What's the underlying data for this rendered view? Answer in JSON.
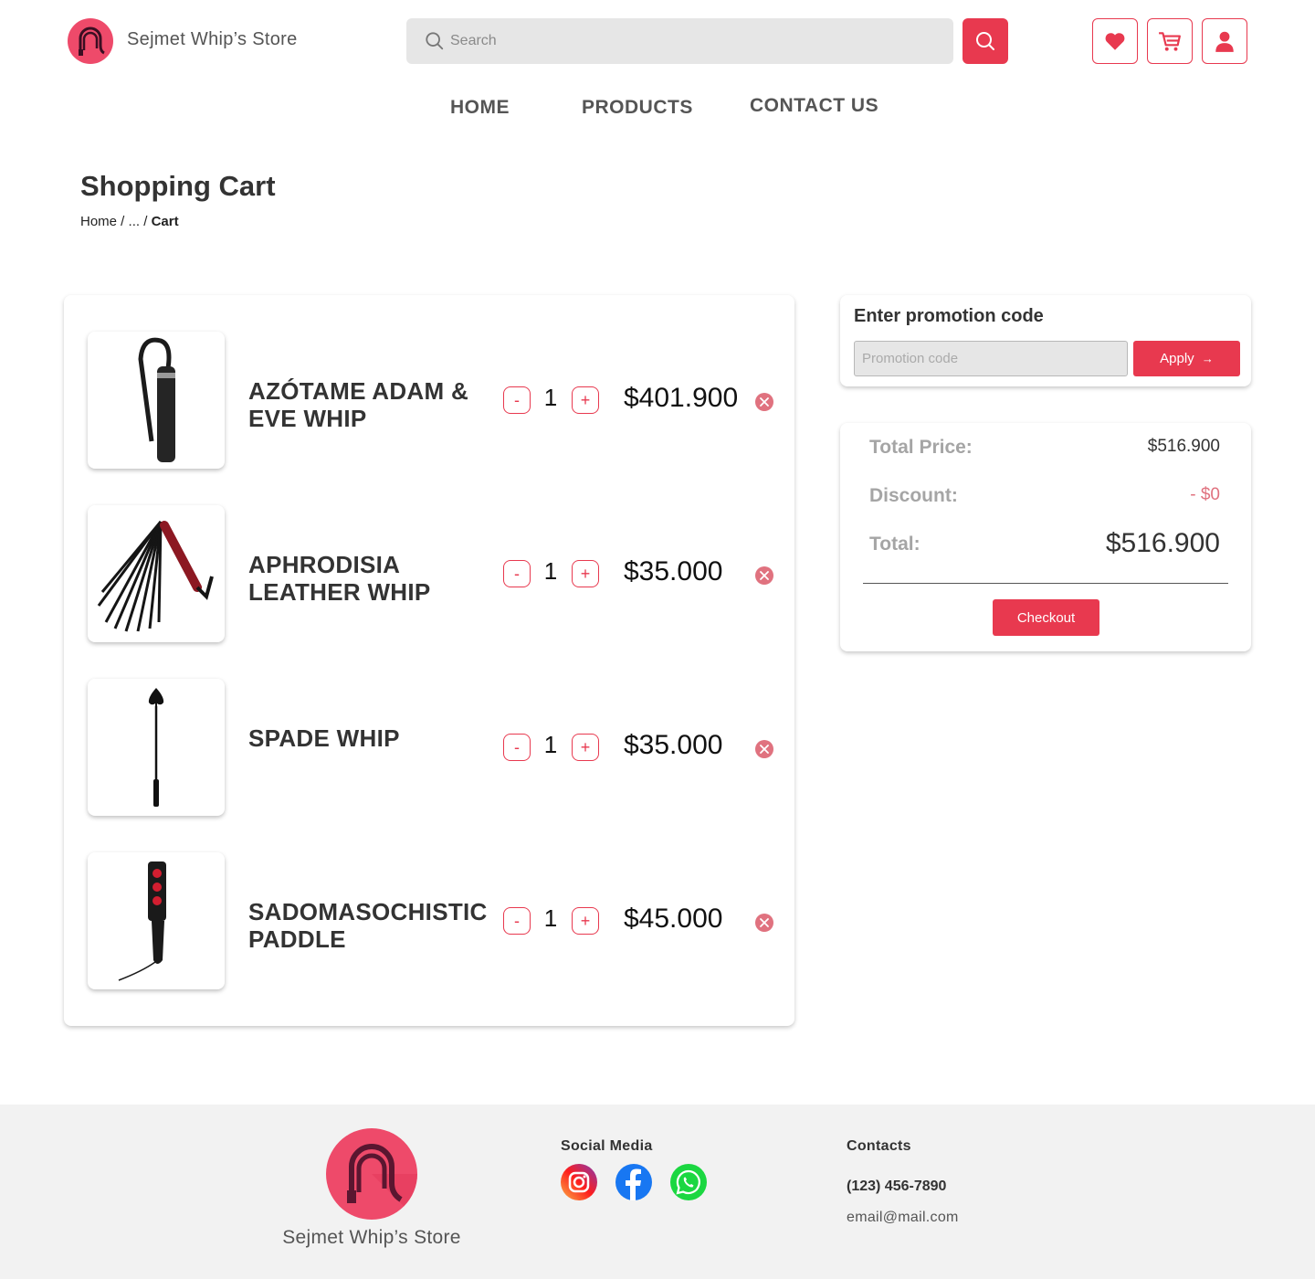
{
  "header": {
    "store_name": "Sejmet Whip’s Store",
    "search_placeholder": "Search",
    "accent_color": "#e8394f"
  },
  "nav": {
    "home": "HOME",
    "products": "PRODUCTS",
    "contact": "CONTACT US"
  },
  "page": {
    "title": "Shopping Cart",
    "breadcrumb": {
      "home": "Home",
      "sep1": " / ",
      "ellipsis": "...",
      "sep2": " /  ",
      "current": "Cart"
    }
  },
  "cart": {
    "items": [
      {
        "name": "AZÓTAME ADAM & EVE WHIP",
        "quantity": "1",
        "price": "$401.900",
        "minus": "-",
        "plus": "+"
      },
      {
        "name": "APHRODISIA LEATHER WHIP",
        "quantity": "1",
        "price": "$35.000",
        "minus": "-",
        "plus": "+"
      },
      {
        "name": "SPADE WHIP",
        "quantity": "1",
        "price": "$35.000",
        "minus": "-",
        "plus": "+"
      },
      {
        "name": "SADOMASOCHISTIC PADDLE",
        "quantity": "1",
        "price": "$45.000",
        "minus": "-",
        "plus": "+"
      }
    ]
  },
  "promo": {
    "title": "Enter promotion code",
    "placeholder": "Promotion code",
    "apply_label": "Apply",
    "apply_arrow": "→"
  },
  "summary": {
    "total_price_label": "Total Price:",
    "total_price_value": "$516.900",
    "discount_label": "Discount:",
    "discount_value": "- $0",
    "total_label": "Total:",
    "total_value": "$516.900",
    "checkout_label": "Checkout",
    "discount_color": "#e0727f"
  },
  "footer": {
    "store_name": "Sejmet Whip’s Store",
    "social_heading": "Social Media",
    "social_icons": [
      "instagram-icon",
      "facebook-icon",
      "whatsapp-icon"
    ],
    "contacts_heading": "Contacts",
    "phone": "(123) 456-7890",
    "email": "email@mail.com"
  }
}
